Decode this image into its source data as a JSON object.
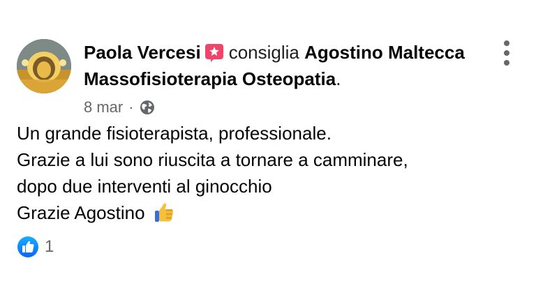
{
  "post": {
    "author": "Paola Vercesi",
    "verb": "consiglia",
    "page_name": "Agostino Maltecca Massofisioterapia Osteopatia",
    "page_name_suffix": ".",
    "date": "8 mar",
    "separator": "·",
    "privacy_icon": "globe-icon",
    "recommend_icon": "recommend-star-icon",
    "more_icon": "more-options-icon",
    "body": {
      "line1": "Un grande fisioterapista, professionale.",
      "line2": "Grazie a lui sono riuscita a tornare a camminare,",
      "line3": "dopo due interventi al ginocchio",
      "line4": "Grazie Agostino",
      "emoji": "thumbs-up-emoji"
    },
    "reactions": {
      "icon": "like-icon",
      "count": "1"
    }
  },
  "colors": {
    "text": "#050505",
    "secondary": "#65676b",
    "like_blue": "#1877f2",
    "badge_pink": "#f0446b"
  }
}
